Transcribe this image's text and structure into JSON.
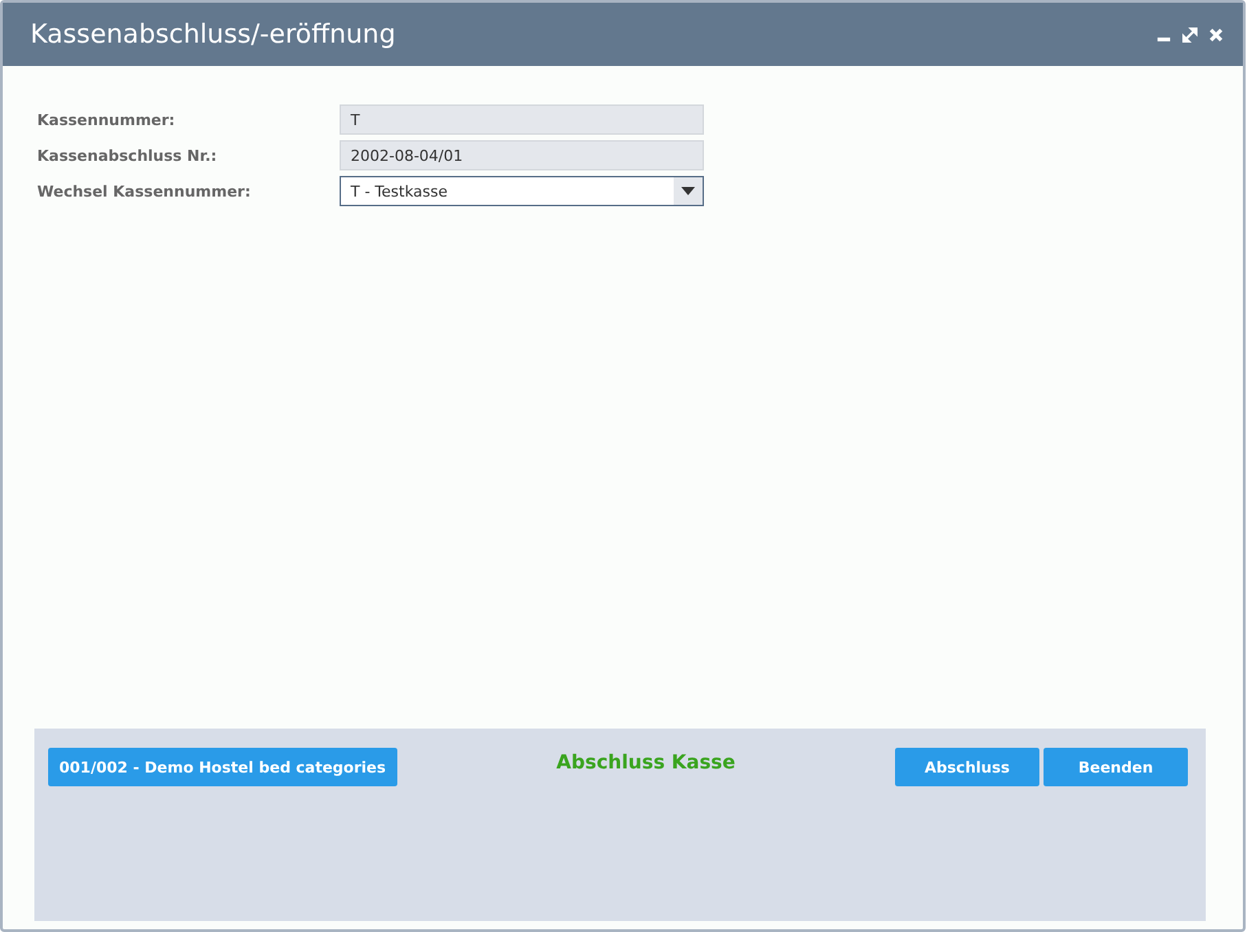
{
  "window": {
    "title": "Kassenabschluss/-eröffnung"
  },
  "fields": [
    {
      "kind": "readonly",
      "label": "Kassennummer:",
      "value": "T"
    },
    {
      "kind": "readonly",
      "label": "Kassenabschluss Nr.:",
      "value": "2002-08-04/01"
    },
    {
      "kind": "dropdown",
      "label": "Wechsel Kassennummer:",
      "value": "T - Testkasse"
    }
  ],
  "footer": {
    "info_button": "001/002 - Demo Hostel bed categories",
    "status": "Abschluss Kasse",
    "buttons": [
      "Abschluss",
      "Beenden"
    ]
  }
}
